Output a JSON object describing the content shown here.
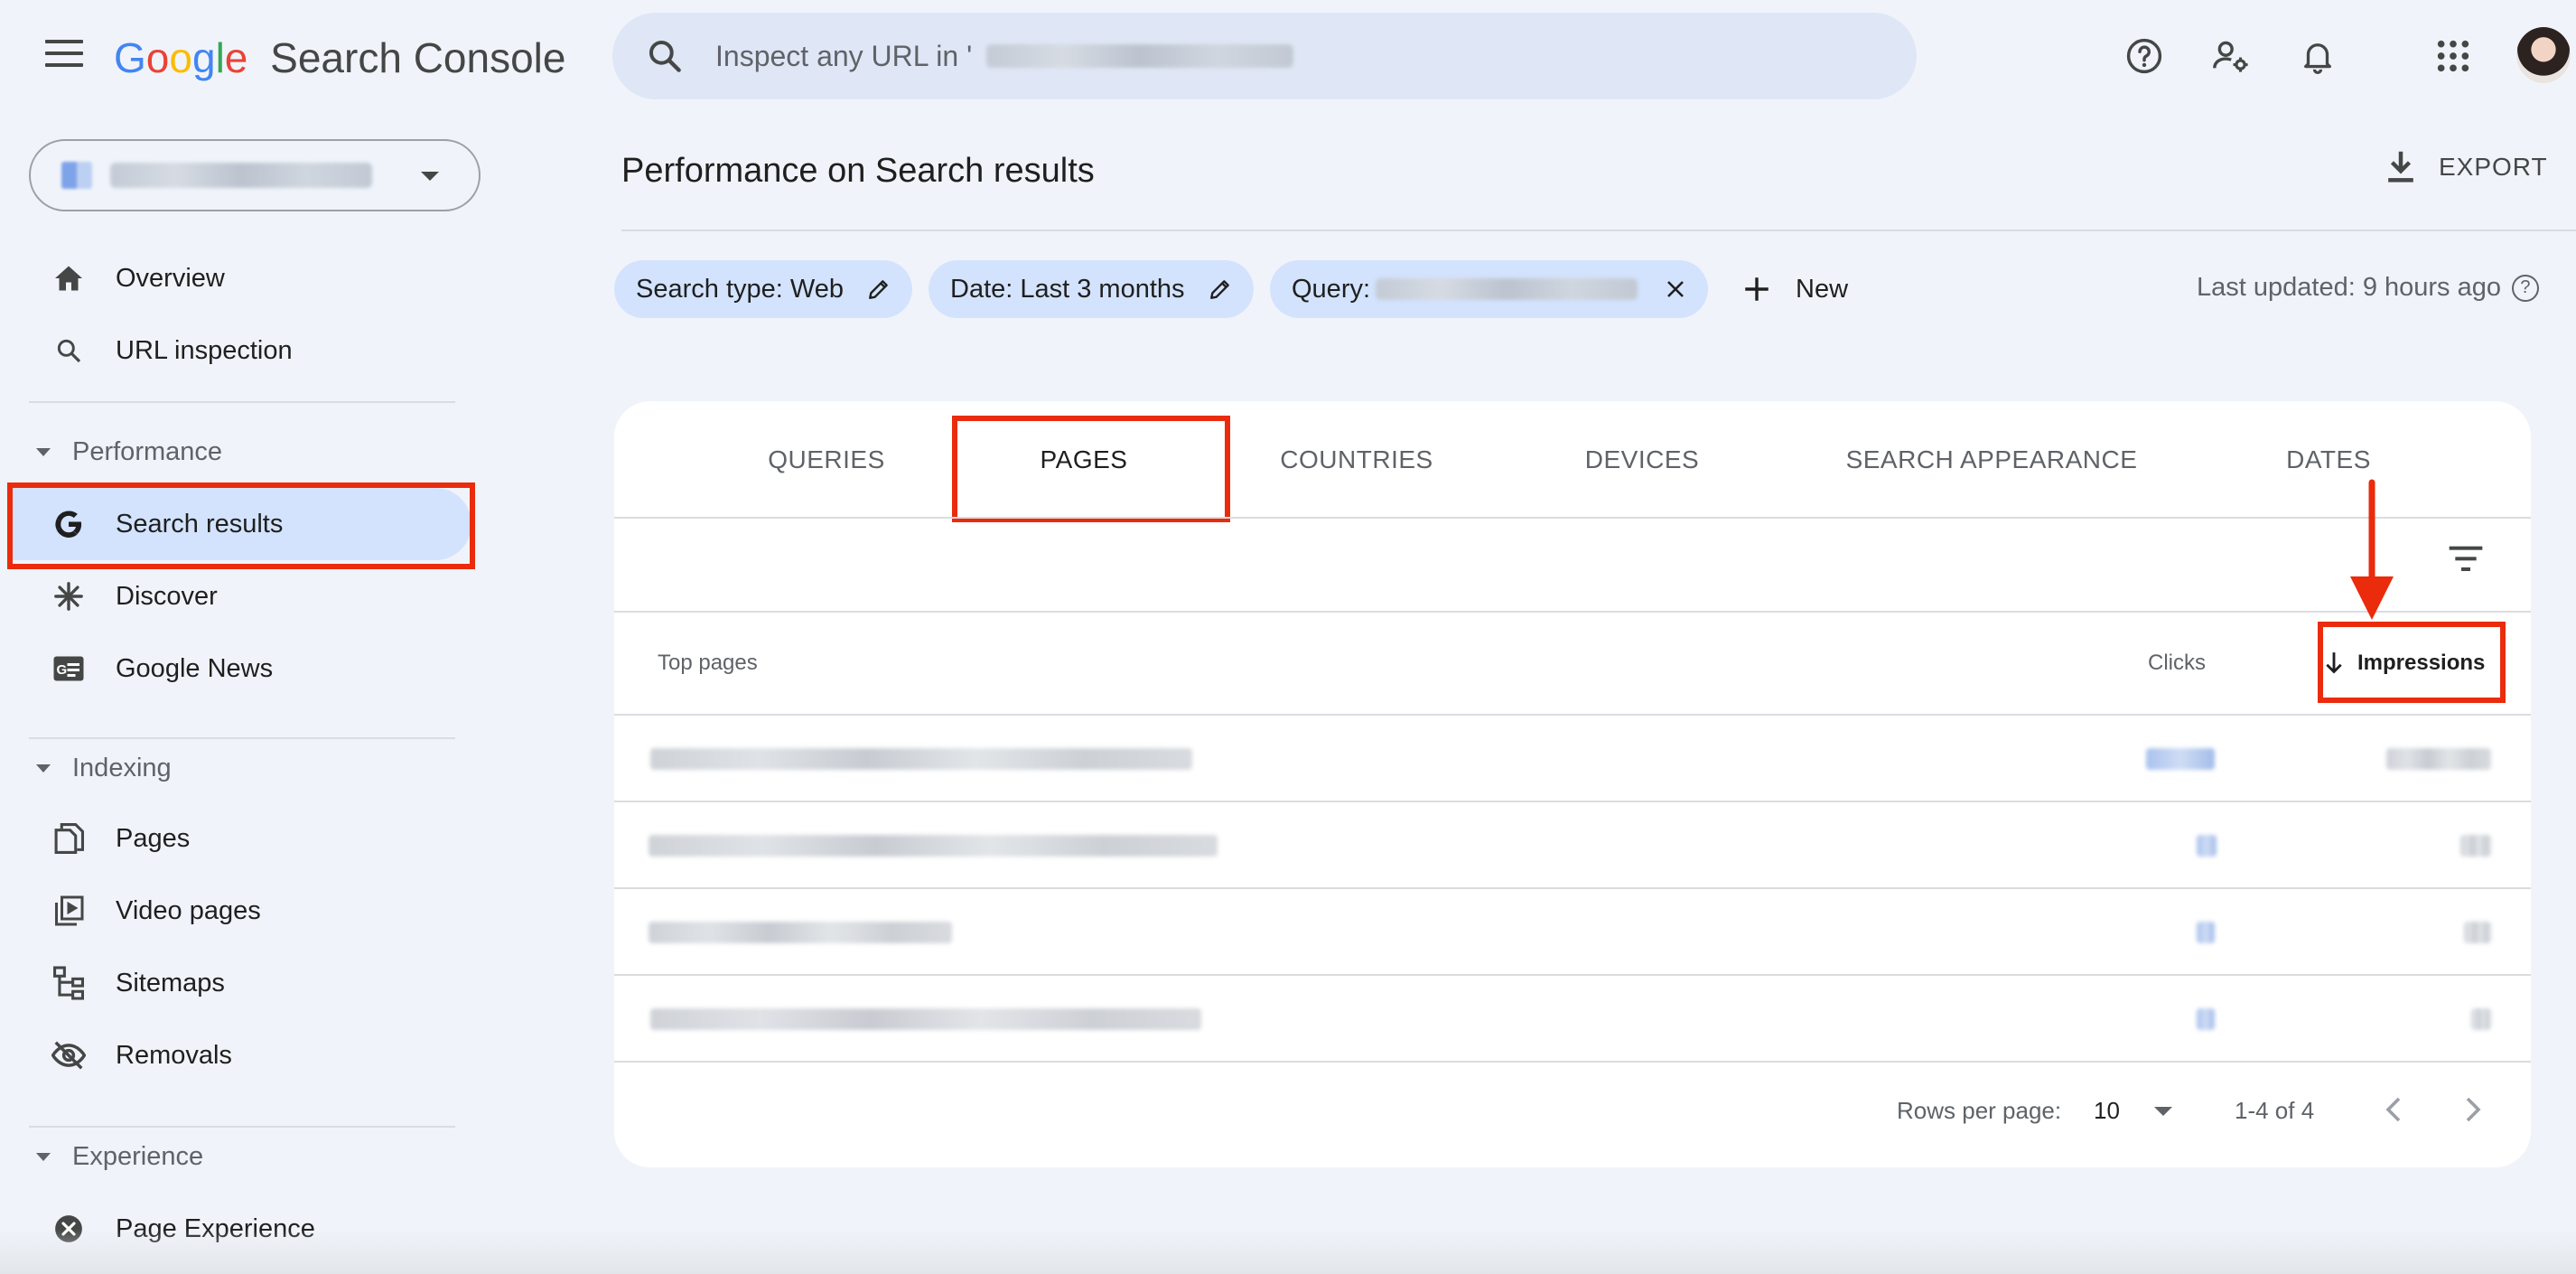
{
  "app": {
    "logo_letters": [
      "G",
      "o",
      "o",
      "g",
      "l",
      "e"
    ],
    "logo_colors": [
      "#4285F4",
      "#EA4335",
      "#FBBC05",
      "#4285F4",
      "#34A853",
      "#EA4335"
    ],
    "product_name": "Search Console"
  },
  "search": {
    "placeholder": "Inspect any URL in '"
  },
  "sidebar": {
    "items": [
      {
        "label": "Overview",
        "icon": "home-icon"
      },
      {
        "label": "URL inspection",
        "icon": "search-icon"
      }
    ],
    "performance": {
      "heading": "Performance",
      "items": [
        {
          "label": "Search results",
          "icon": "google-g-icon",
          "active": true
        },
        {
          "label": "Discover",
          "icon": "asterisk-icon"
        },
        {
          "label": "Google News",
          "icon": "google-news-icon"
        }
      ]
    },
    "indexing": {
      "heading": "Indexing",
      "items": [
        {
          "label": "Pages",
          "icon": "pages-icon"
        },
        {
          "label": "Video pages",
          "icon": "video-pages-icon"
        },
        {
          "label": "Sitemaps",
          "icon": "sitemap-icon"
        },
        {
          "label": "Removals",
          "icon": "eye-off-icon"
        }
      ]
    },
    "experience": {
      "heading": "Experience",
      "items": [
        {
          "label": "Page Experience",
          "icon": "page-experience-icon"
        }
      ]
    }
  },
  "header": {
    "title": "Performance on Search results",
    "export_label": "EXPORT",
    "last_updated": "Last updated: 9 hours ago",
    "help_glyph": "?"
  },
  "filters": {
    "search_type": "Search type: Web",
    "date": "Date: Last 3 months",
    "query": "Query:",
    "new_label": "New"
  },
  "tabs": [
    {
      "label": "QUERIES",
      "active": false
    },
    {
      "label": "PAGES",
      "active": true
    },
    {
      "label": "COUNTRIES",
      "active": false
    },
    {
      "label": "DEVICES",
      "active": false
    },
    {
      "label": "SEARCH APPEARANCE",
      "active": false
    },
    {
      "label": "DATES",
      "active": false
    }
  ],
  "table": {
    "columns": {
      "pages": "Top pages",
      "clicks": "Clicks",
      "impressions": "Impressions"
    },
    "sorted_by": "impressions",
    "sort_direction": "descending"
  },
  "pagination": {
    "rows_per_page_label": "Rows per page:",
    "rows_per_page": "10",
    "range": "1-4 of 4"
  },
  "colors": {
    "accent": "#d3e3fd",
    "highlight": "#ea2b0c",
    "background": "#f0f4fa"
  }
}
